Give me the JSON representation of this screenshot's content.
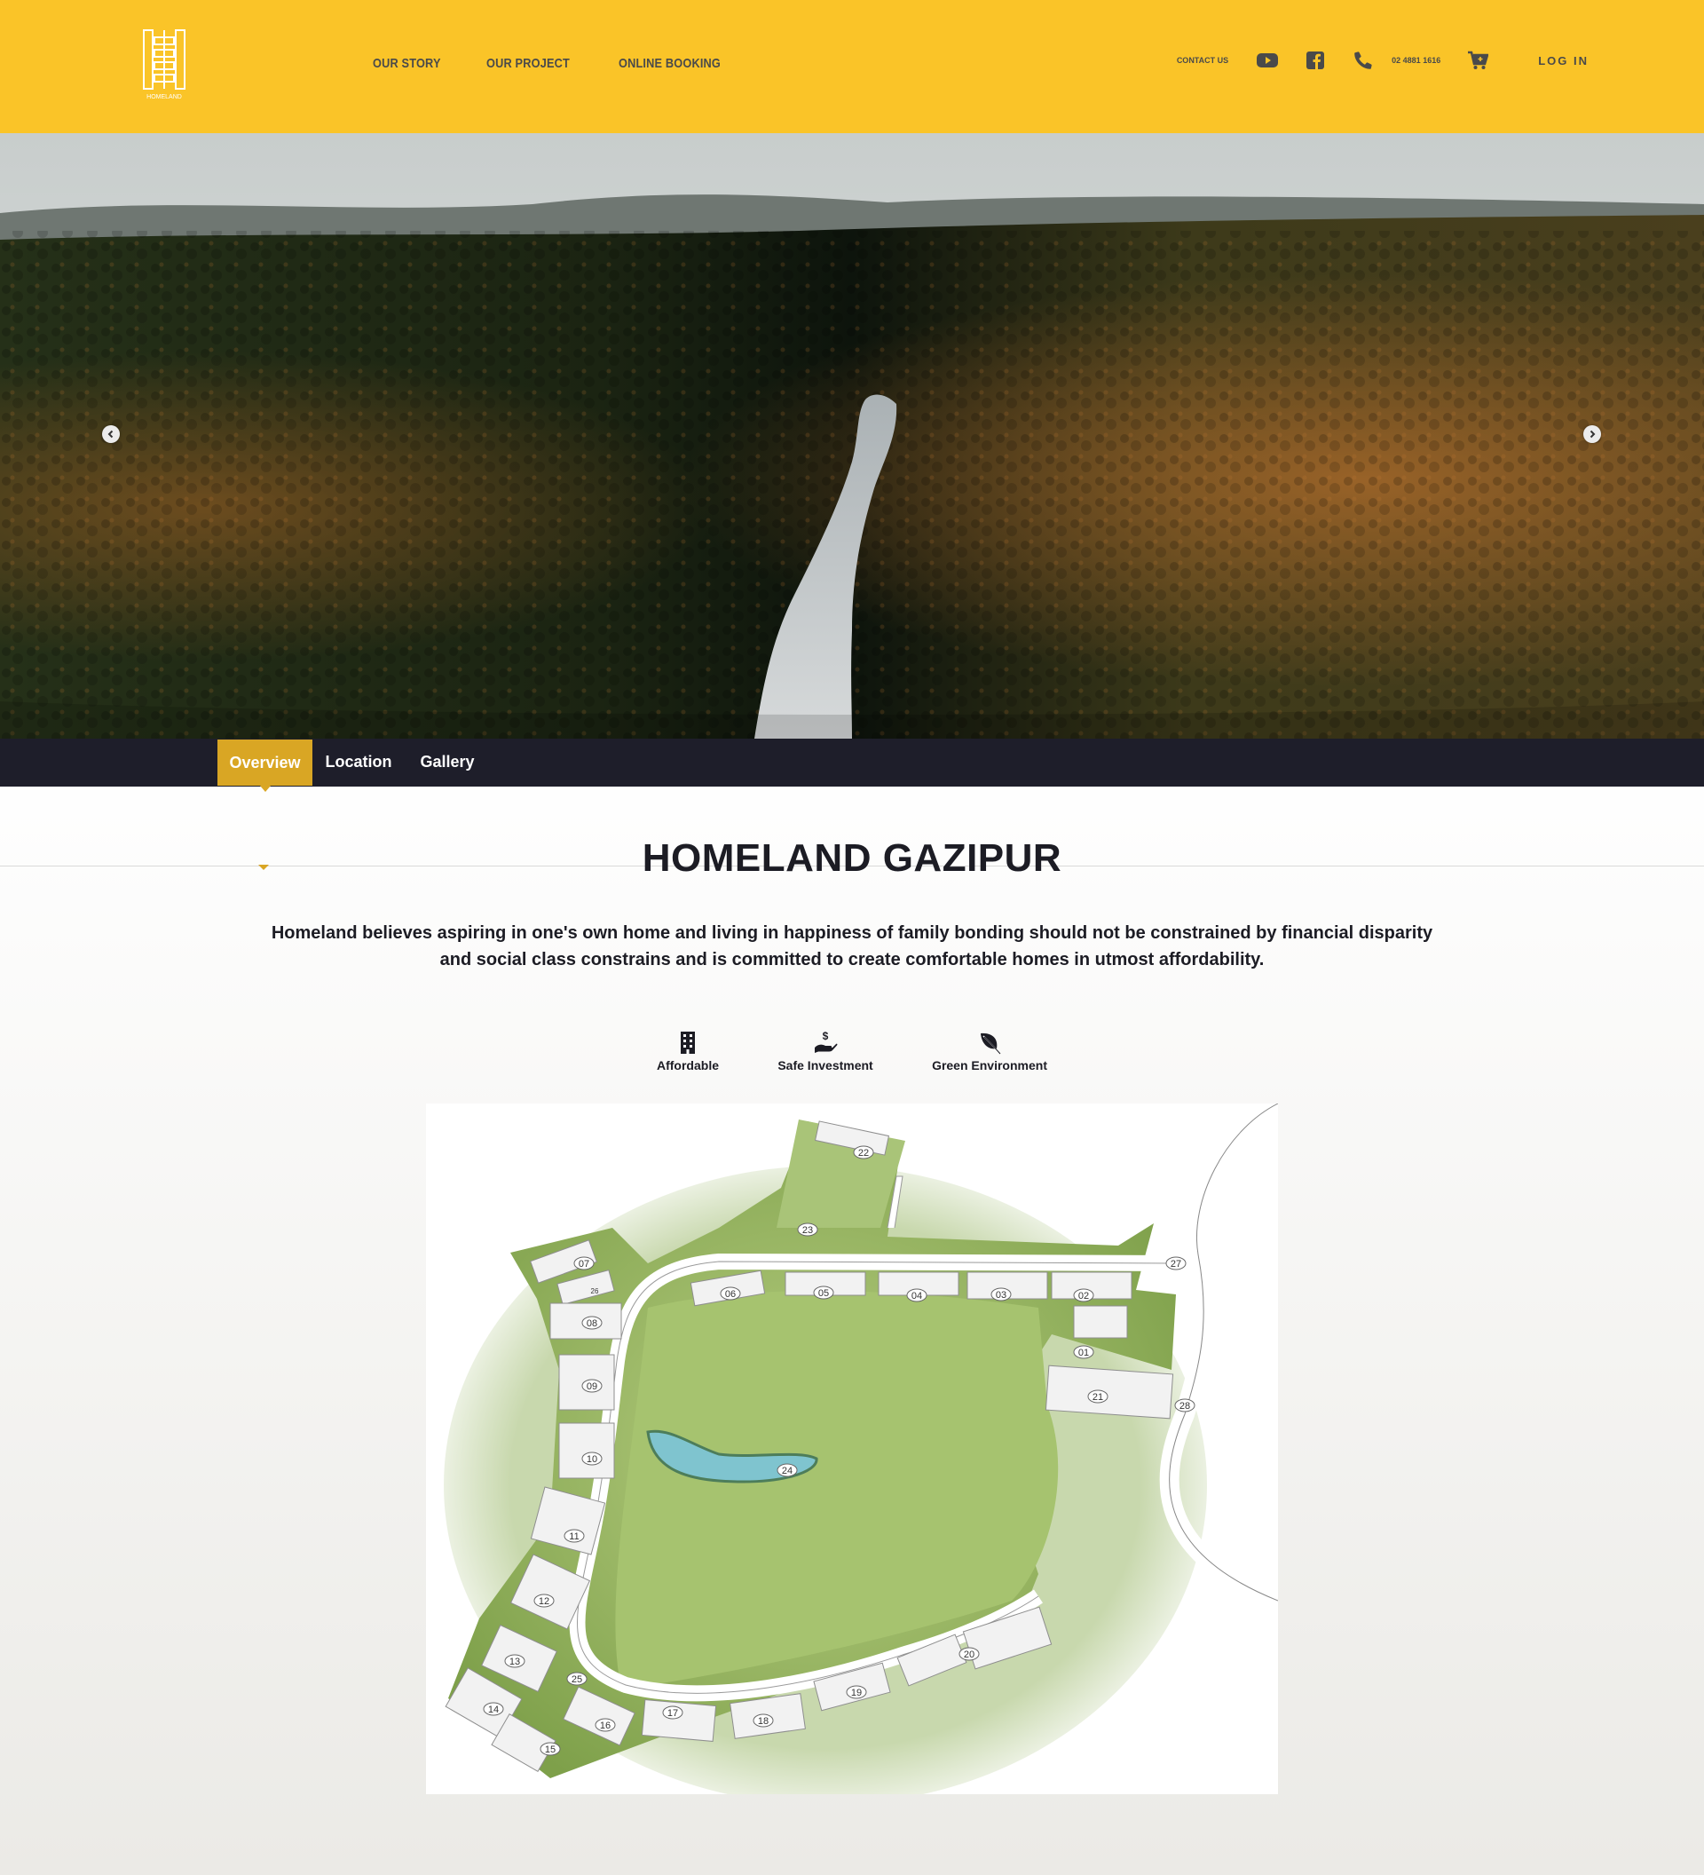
{
  "header": {
    "logo_text": "HOMELAND",
    "nav": [
      "OUR STORY",
      "OUR PROJECT",
      "ONLINE BOOKING"
    ],
    "contact_label": "CONTACT US",
    "phone": "02 4881 1616",
    "login_label": "LOG IN",
    "icons": [
      "youtube-icon",
      "facebook-icon",
      "phone-icon",
      "cart-icon"
    ]
  },
  "hero": {
    "prev_icon": "chevron-left-icon",
    "next_icon": "chevron-right-icon"
  },
  "tabs": {
    "items": [
      {
        "label": "Overview",
        "active": true
      },
      {
        "label": "Location",
        "active": false
      },
      {
        "label": "Gallery",
        "active": false
      }
    ]
  },
  "main": {
    "title": "HOMELAND GAZIPUR",
    "description": "Homeland believes aspiring in one's own home and living in happiness of family bonding should not be constrained by financial disparity and social class constrains and is committed to create comfortable homes in utmost affordability.",
    "features": [
      {
        "label": "Affordable",
        "icon": "building-icon"
      },
      {
        "label": "Safe Investment",
        "icon": "money-hand-icon"
      },
      {
        "label": "Green Environment",
        "icon": "leaf-icon"
      }
    ]
  },
  "site_plan": {
    "plot_labels": [
      "22",
      "23",
      "07",
      "26",
      "08",
      "09",
      "10",
      "11",
      "12",
      "13",
      "14",
      "15",
      "16",
      "17",
      "18",
      "19",
      "20",
      "21",
      "24",
      "25",
      "27",
      "28",
      "06",
      "05",
      "04",
      "03",
      "02",
      "01"
    ]
  },
  "colors": {
    "header_bg": "#fac428",
    "tab_bar_bg": "#1e1e2a",
    "tab_active_bg": "#d9a624"
  }
}
